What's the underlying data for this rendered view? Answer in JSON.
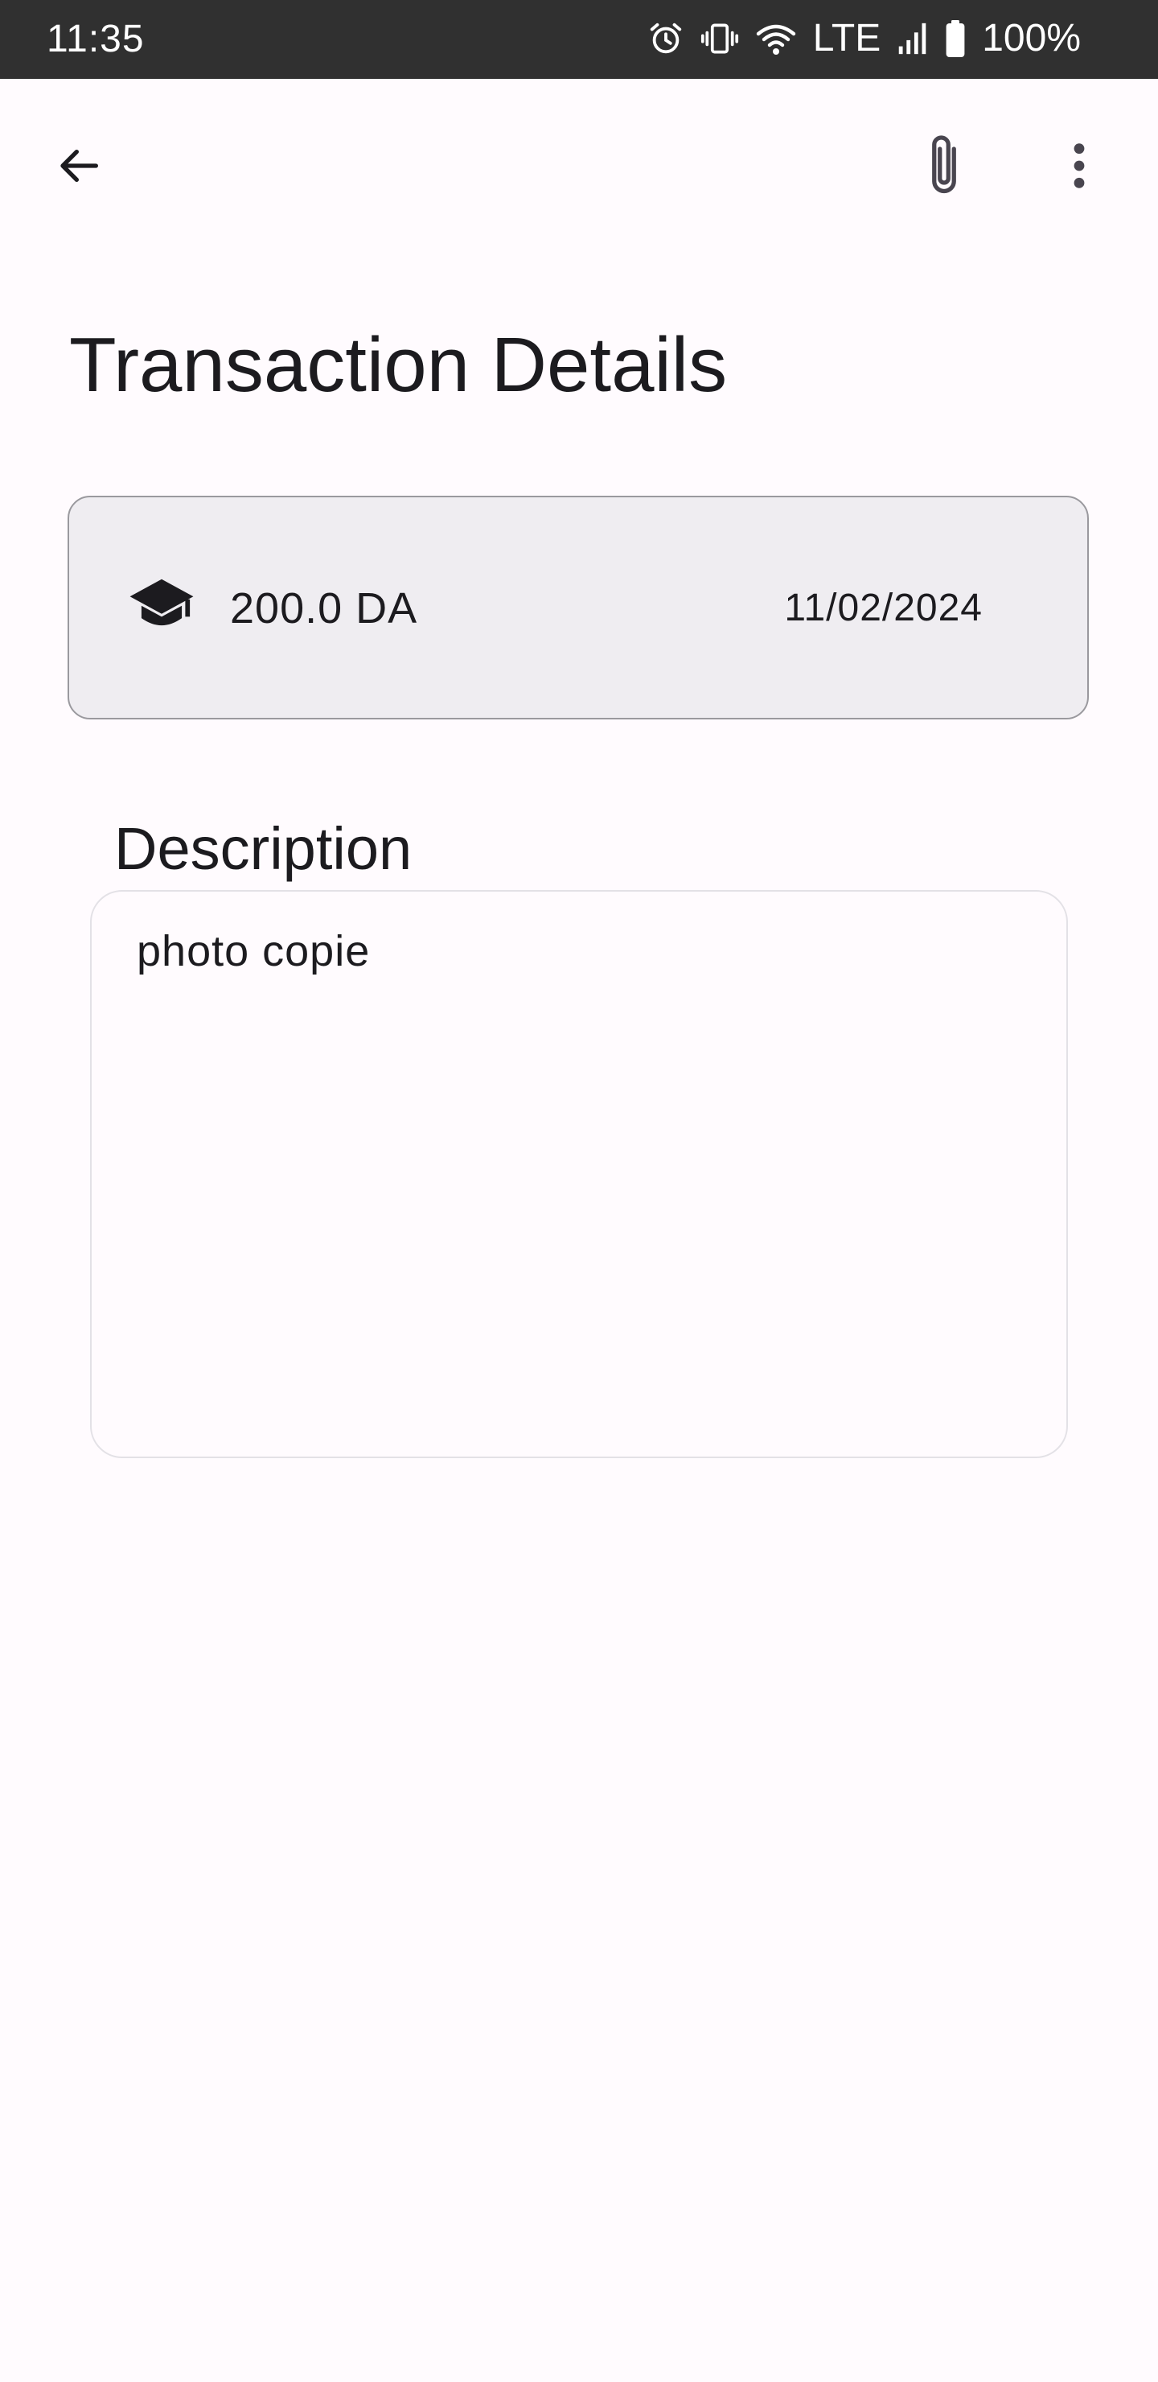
{
  "status_bar": {
    "time": "11:35",
    "network": "LTE",
    "battery": "100%",
    "icons": [
      "alarm-icon",
      "vibrate-icon",
      "wifi-icon",
      "signal-icon",
      "battery-icon"
    ]
  },
  "app_bar": {
    "icons": [
      "arrow-back-icon",
      "paperclip-icon",
      "more-vert-icon"
    ]
  },
  "page": {
    "title": "Transaction Details"
  },
  "transaction": {
    "category_icon": "graduation-cap-icon",
    "amount": "200.0 DA",
    "date": "11/02/2024"
  },
  "description": {
    "label": "Description",
    "value": "photo copie"
  },
  "colors": {
    "background": "#fffbfe",
    "status_bar": "#303030",
    "card_background": "#efedf1",
    "text": "#1c1b1f"
  }
}
